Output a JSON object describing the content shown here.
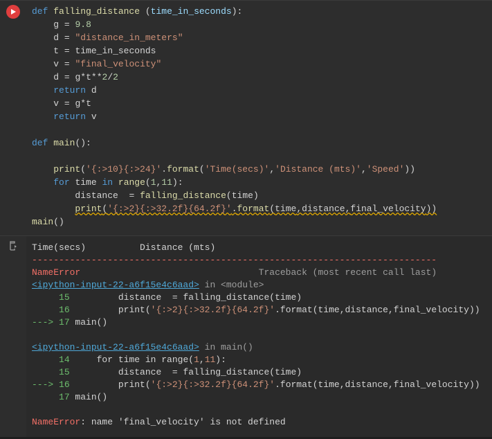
{
  "code": {
    "lines": [
      {
        "indent": 0,
        "plain": "",
        "html": "<span class='kw'>def</span> <span class='fn'>falling_distance</span> <span class='op'>(</span><span class='param'>time_in_seconds</span><span class='op'>):</span>"
      },
      {
        "html": "    <span class='id'>g</span> <span class='op'>=</span> <span class='num'>9.8</span>"
      },
      {
        "html": "    <span class='id'>d</span> <span class='op'>=</span> <span class='str'>\"distance_in_meters\"</span>"
      },
      {
        "html": "    <span class='id'>t</span> <span class='op'>=</span> <span class='id'>time_in_seconds</span>"
      },
      {
        "html": "    <span class='id'>v</span> <span class='op'>=</span> <span class='str'>\"final_velocity\"</span>"
      },
      {
        "html": "    <span class='id'>d</span> <span class='op'>=</span> <span class='id'>g</span><span class='op'>*</span><span class='id'>t</span><span class='op'>**</span><span class='num'>2</span><span class='op'>/</span><span class='num'>2</span>"
      },
      {
        "html": "    <span class='kw'>return</span> <span class='id'>d</span>"
      },
      {
        "html": "    <span class='id'>v</span> <span class='op'>=</span> <span class='id'>g</span><span class='op'>*</span><span class='id'>t</span>"
      },
      {
        "html": "    <span class='kw'>return</span> <span class='id'>v</span>"
      },
      {
        "html": ""
      },
      {
        "html": "<span class='kw'>def</span> <span class='fn'>main</span><span class='op'>():</span>"
      },
      {
        "html": ""
      },
      {
        "html": "    <span class='fn'>print</span><span class='op'>(</span><span class='str'>'{:>10}{:>24}'</span><span class='op'>.</span><span class='fn'>format</span><span class='op'>(</span><span class='str'>'Time(secs)'</span><span class='op'>,</span><span class='str'>'Distance (mts)'</span><span class='op'>,</span><span class='str'>'Speed'</span><span class='op'>))</span>"
      },
      {
        "html": "    <span class='kw'>for</span> <span class='id'>time</span> <span class='kw'>in</span> <span class='fn'>range</span><span class='op'>(</span><span class='num'>1</span><span class='op'>,</span><span class='num'>11</span><span class='op'>):</span>"
      },
      {
        "html": "        <span class='id'>distance</span>  <span class='op'>=</span> <span class='fn'>falling_distance</span><span class='op'>(</span><span class='id'>time</span><span class='op'>)</span>"
      },
      {
        "html": "        <span class='squiggle'><span class='fn'>print</span><span class='op'>(</span><span class='str'>'{:>2}{:>32.2f}{64.2f}'</span><span class='op'>.</span><span class='fn'>format</span><span class='op'>(</span><span class='id'>time</span><span class='op'>,</span><span class='id'>distance</span><span class='op'>,</span><span class='id'>final_velocity</span><span class='op'>))</span></span>"
      },
      {
        "html": "<span class='fn'>main</span><span class='op'>()</span>"
      }
    ]
  },
  "output": {
    "header": "Time(secs)          Distance (mts)",
    "dash": "---------------------------------------------------------------------------",
    "error_name": "NameError",
    "traceback_label": "Traceback (most recent call last)",
    "frame1_link": "<ipython-input-22-a6f15e4c6aad>",
    "frame1_in": " in <module>",
    "frame1_lines": [
      {
        "arrow": "     ",
        "num": "15",
        "text": "         distance  = falling_distance(time)"
      },
      {
        "arrow": "     ",
        "num": "16",
        "text": "         print(",
        "str": "'{:>2}{:>32.2f}{64.2f}'",
        "text2": ".format(time,distance,final_velocity))"
      },
      {
        "arrow": "---> ",
        "num": "17",
        "text": " main()"
      }
    ],
    "frame2_link": "<ipython-input-22-a6f15e4c6aad>",
    "frame2_in": " in main()",
    "frame2_lines": [
      {
        "arrow": "     ",
        "num": "14",
        "text": "     for time in range(",
        "str": "1",
        "text2": ",",
        "str2": "11",
        "text3": "):",
        "nums": true
      },
      {
        "arrow": "     ",
        "num": "15",
        "text": "         distance  = falling_distance(time)"
      },
      {
        "arrow": "---> ",
        "num": "16",
        "text": "         print(",
        "str": "'{:>2}{:>32.2f}{64.2f}'",
        "text2": ".format(time,distance,final_velocity))"
      },
      {
        "arrow": "     ",
        "num": "17",
        "text": " main()"
      }
    ],
    "final_err": "NameError",
    "final_msg": ": name 'final_velocity' is not defined"
  }
}
